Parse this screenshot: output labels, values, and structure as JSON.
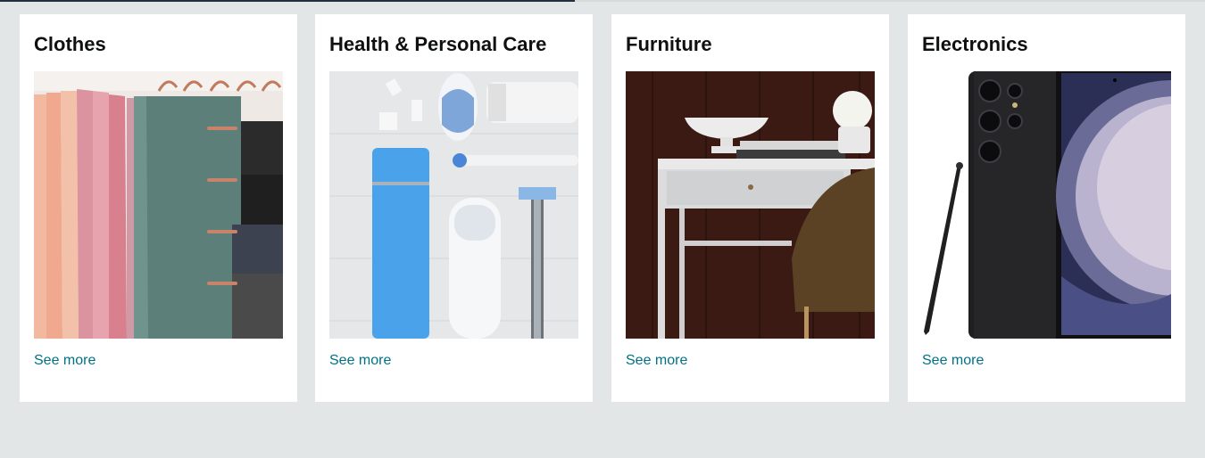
{
  "cards": [
    {
      "title": "Clothes",
      "link": "See more",
      "image": "clothes-hanging-image"
    },
    {
      "title": "Health & Personal Care",
      "link": "See more",
      "image": "personal-care-products-image"
    },
    {
      "title": "Furniture",
      "link": "See more",
      "image": "white-desk-image"
    },
    {
      "title": "Electronics",
      "link": "See more",
      "image": "smartphone-with-stylus-image"
    }
  ],
  "colors": {
    "background": "#e3e6e6",
    "link": "#007185",
    "card": "#ffffff"
  }
}
